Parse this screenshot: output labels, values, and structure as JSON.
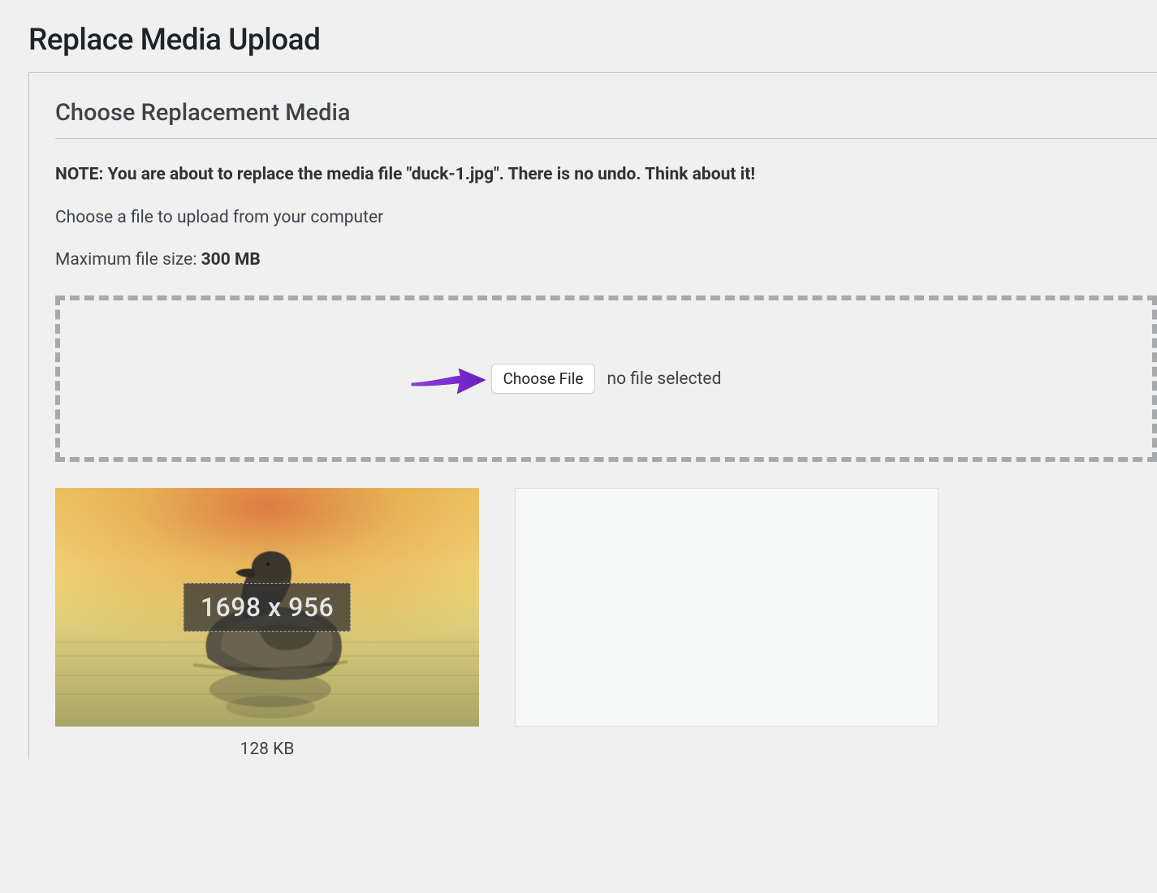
{
  "page": {
    "title": "Replace Media Upload"
  },
  "section": {
    "heading": "Choose Replacement Media",
    "note_prefix": "NOTE: You are about to replace the media file \"",
    "filename": "duck-1.jpg",
    "note_suffix": "\". There is no undo. Think about it!",
    "instruction": "Choose a file to upload from your computer",
    "max_label": "Maximum file size: ",
    "max_value": "300 MB"
  },
  "upload": {
    "choose_label": "Choose File",
    "no_file_text": "no file selected"
  },
  "preview": {
    "current": {
      "dimensions": "1698 x 956",
      "filesize": "128 KB"
    }
  },
  "colors": {
    "arrow": "#7a2ec7"
  }
}
